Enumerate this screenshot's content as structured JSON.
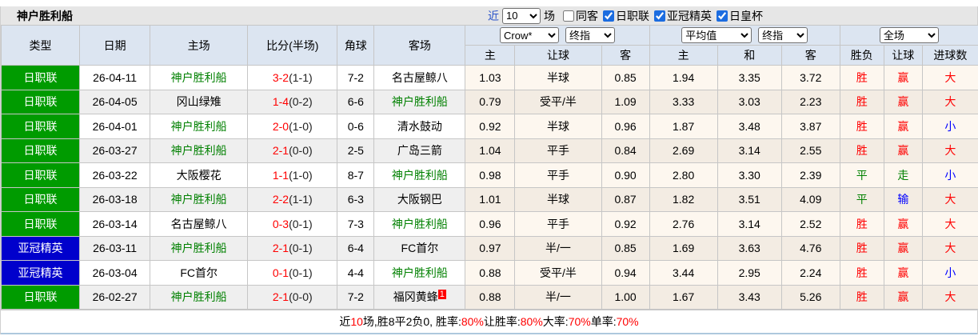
{
  "title": "神户胜利船",
  "toolbar": {
    "recent_label": "近",
    "recent_value": "10",
    "matches_label": "场",
    "checkboxes": [
      {
        "label": "同客",
        "checked": false
      },
      {
        "label": "日职联",
        "checked": true
      },
      {
        "label": "亚冠精英",
        "checked": true
      },
      {
        "label": "日皇杯",
        "checked": true
      }
    ]
  },
  "table": {
    "left_columns": [
      "类型",
      "日期",
      "主场",
      "比分(半场)",
      "角球",
      "客场"
    ],
    "odds_group": {
      "select1": "Crow*",
      "select2": "终指",
      "cols": [
        "主",
        "让球",
        "客"
      ]
    },
    "avg_group": {
      "select1": "平均值",
      "select2": "终指",
      "cols": [
        "主",
        "和",
        "客"
      ]
    },
    "result_group": {
      "select": "全场",
      "cols": [
        "胜负",
        "让球",
        "进球数"
      ]
    },
    "rows": [
      {
        "type": "日职联",
        "type_color": "green",
        "date": "26-04-11",
        "home": "神户胜利船",
        "home_hl": true,
        "score": "3-2",
        "half": "(1-1)",
        "corner": "7-2",
        "away": "名古屋鲸八",
        "away_hl": false,
        "away_badge": "",
        "crow": [
          "1.03",
          "半球",
          "0.85"
        ],
        "avg": [
          "1.94",
          "3.35",
          "3.72"
        ],
        "outcome": "胜",
        "outcome_c": "red",
        "let": "赢",
        "let_c": "red",
        "goals": "大",
        "goals_c": "red"
      },
      {
        "type": "日职联",
        "type_color": "green",
        "date": "26-04-05",
        "home": "冈山绿雉",
        "home_hl": false,
        "score": "1-4",
        "half": "(0-2)",
        "corner": "6-6",
        "away": "神户胜利船",
        "away_hl": true,
        "away_badge": "",
        "crow": [
          "0.79",
          "受平/半",
          "1.09"
        ],
        "avg": [
          "3.33",
          "3.03",
          "2.23"
        ],
        "outcome": "胜",
        "outcome_c": "red",
        "let": "赢",
        "let_c": "red",
        "goals": "大",
        "goals_c": "red"
      },
      {
        "type": "日职联",
        "type_color": "green",
        "date": "26-04-01",
        "home": "神户胜利船",
        "home_hl": true,
        "score": "2-0",
        "half": "(1-0)",
        "corner": "0-6",
        "away": "清水鼓动",
        "away_hl": false,
        "away_badge": "",
        "crow": [
          "0.92",
          "半球",
          "0.96"
        ],
        "avg": [
          "1.87",
          "3.48",
          "3.87"
        ],
        "outcome": "胜",
        "outcome_c": "red",
        "let": "赢",
        "let_c": "red",
        "goals": "小",
        "goals_c": "blue"
      },
      {
        "type": "日职联",
        "type_color": "green",
        "date": "26-03-27",
        "home": "神户胜利船",
        "home_hl": true,
        "score": "2-1",
        "half": "(0-0)",
        "corner": "2-5",
        "away": "广岛三箭",
        "away_hl": false,
        "away_badge": "",
        "crow": [
          "1.04",
          "平手",
          "0.84"
        ],
        "avg": [
          "2.69",
          "3.14",
          "2.55"
        ],
        "outcome": "胜",
        "outcome_c": "red",
        "let": "赢",
        "let_c": "red",
        "goals": "大",
        "goals_c": "red"
      },
      {
        "type": "日职联",
        "type_color": "green",
        "date": "26-03-22",
        "home": "大阪樱花",
        "home_hl": false,
        "score": "1-1",
        "half": "(1-0)",
        "corner": "8-7",
        "away": "神户胜利船",
        "away_hl": true,
        "away_badge": "",
        "crow": [
          "0.98",
          "平手",
          "0.90"
        ],
        "avg": [
          "2.80",
          "3.30",
          "2.39"
        ],
        "outcome": "平",
        "outcome_c": "green",
        "let": "走",
        "let_c": "green",
        "goals": "小",
        "goals_c": "blue"
      },
      {
        "type": "日职联",
        "type_color": "green",
        "date": "26-03-18",
        "home": "神户胜利船",
        "home_hl": true,
        "score": "2-2",
        "half": "(1-1)",
        "corner": "6-3",
        "away": "大阪钢巴",
        "away_hl": false,
        "away_badge": "",
        "crow": [
          "1.01",
          "半球",
          "0.87"
        ],
        "avg": [
          "1.82",
          "3.51",
          "4.09"
        ],
        "outcome": "平",
        "outcome_c": "green",
        "let": "输",
        "let_c": "blue",
        "goals": "大",
        "goals_c": "red"
      },
      {
        "type": "日职联",
        "type_color": "green",
        "date": "26-03-14",
        "home": "名古屋鲸八",
        "home_hl": false,
        "score": "0-3",
        "half": "(0-1)",
        "corner": "7-3",
        "away": "神户胜利船",
        "away_hl": true,
        "away_badge": "",
        "crow": [
          "0.96",
          "平手",
          "0.92"
        ],
        "avg": [
          "2.76",
          "3.14",
          "2.52"
        ],
        "outcome": "胜",
        "outcome_c": "red",
        "let": "赢",
        "let_c": "red",
        "goals": "大",
        "goals_c": "red"
      },
      {
        "type": "亚冠精英",
        "type_color": "blue",
        "date": "26-03-11",
        "home": "神户胜利船",
        "home_hl": true,
        "score": "2-1",
        "half": "(0-1)",
        "corner": "6-4",
        "away": "FC首尔",
        "away_hl": false,
        "away_badge": "",
        "crow": [
          "0.97",
          "半/一",
          "0.85"
        ],
        "avg": [
          "1.69",
          "3.63",
          "4.76"
        ],
        "outcome": "胜",
        "outcome_c": "red",
        "let": "赢",
        "let_c": "red",
        "goals": "大",
        "goals_c": "red"
      },
      {
        "type": "亚冠精英",
        "type_color": "blue",
        "date": "26-03-04",
        "home": "FC首尔",
        "home_hl": false,
        "score": "0-1",
        "half": "(0-1)",
        "corner": "4-4",
        "away": "神户胜利船",
        "away_hl": true,
        "away_badge": "",
        "crow": [
          "0.88",
          "受平/半",
          "0.94"
        ],
        "avg": [
          "3.44",
          "2.95",
          "2.24"
        ],
        "outcome": "胜",
        "outcome_c": "red",
        "let": "赢",
        "let_c": "red",
        "goals": "小",
        "goals_c": "blue"
      },
      {
        "type": "日职联",
        "type_color": "green",
        "date": "26-02-27",
        "home": "神户胜利船",
        "home_hl": true,
        "score": "2-1",
        "half": "(0-0)",
        "corner": "7-2",
        "away": "福冈黄蜂",
        "away_hl": false,
        "away_badge": "1",
        "crow": [
          "0.88",
          "半/一",
          "1.00"
        ],
        "avg": [
          "1.67",
          "3.43",
          "5.26"
        ],
        "outcome": "胜",
        "outcome_c": "red",
        "let": "赢",
        "let_c": "red",
        "goals": "大",
        "goals_c": "red"
      }
    ]
  },
  "footer": {
    "parts": [
      {
        "text": "近",
        "red": false
      },
      {
        "text": "10",
        "red": true
      },
      {
        "text": "场,胜8平2负0, 胜率:",
        "red": false
      },
      {
        "text": "80%",
        "red": true
      },
      {
        "text": " 让胜率:",
        "red": false
      },
      {
        "text": "80%",
        "red": true
      },
      {
        "text": " 大率:",
        "red": false
      },
      {
        "text": "70%",
        "red": true
      },
      {
        "text": " 单率:",
        "red": false
      },
      {
        "text": "70%",
        "red": true
      }
    ]
  },
  "colors": {
    "league_green": "#009b00",
    "league_blue": "#0000cc",
    "team_highlight_green": "#008000",
    "result_red": "#ff0000",
    "result_blue": "#0000ff",
    "header_bg": "#dce5f1"
  }
}
